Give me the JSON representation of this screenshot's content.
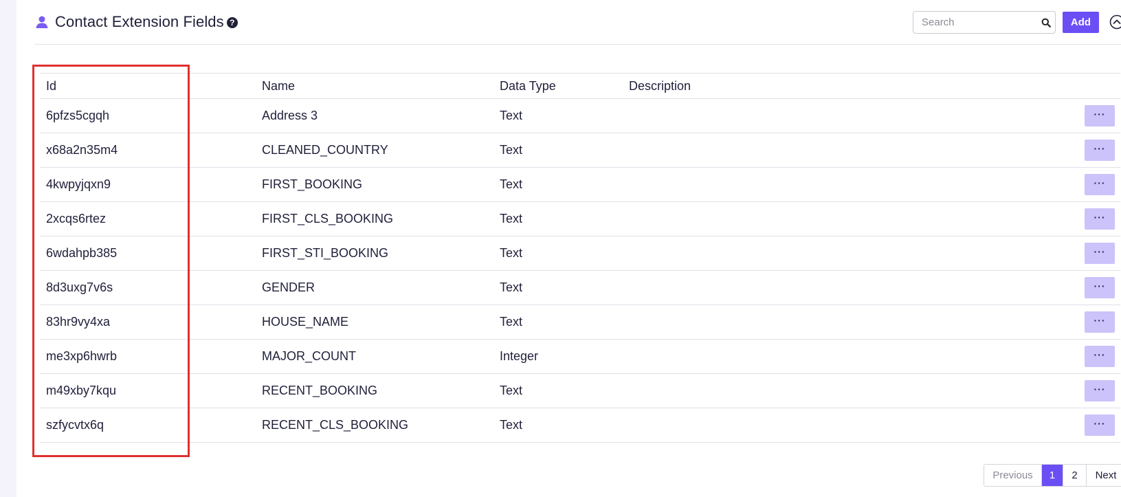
{
  "header": {
    "title": "Contact Extension Fields",
    "help_glyph": "?",
    "search_placeholder": "Search",
    "add_label": "Add"
  },
  "table": {
    "columns": [
      "Id",
      "Name",
      "Data Type",
      "Description"
    ],
    "rows": [
      {
        "id": "6pfzs5cgqh",
        "name": "Address 3",
        "type": "Text",
        "description": ""
      },
      {
        "id": "x68a2n35m4",
        "name": "CLEANED_COUNTRY",
        "type": "Text",
        "description": ""
      },
      {
        "id": "4kwpyjqxn9",
        "name": "FIRST_BOOKING",
        "type": "Text",
        "description": ""
      },
      {
        "id": "2xcqs6rtez",
        "name": "FIRST_CLS_BOOKING",
        "type": "Text",
        "description": ""
      },
      {
        "id": "6wdahpb385",
        "name": "FIRST_STI_BOOKING",
        "type": "Text",
        "description": ""
      },
      {
        "id": "8d3uxg7v6s",
        "name": "GENDER",
        "type": "Text",
        "description": ""
      },
      {
        "id": "83hr9vy4xa",
        "name": "HOUSE_NAME",
        "type": "Text",
        "description": ""
      },
      {
        "id": "me3xp6hwrb",
        "name": "MAJOR_COUNT",
        "type": "Integer",
        "description": ""
      },
      {
        "id": "m49xby7kqu",
        "name": "RECENT_BOOKING",
        "type": "Text",
        "description": ""
      },
      {
        "id": "szfycvtx6q",
        "name": "RECENT_CLS_BOOKING",
        "type": "Text",
        "description": ""
      }
    ],
    "row_action_label": "···"
  },
  "pagination": {
    "previous_label": "Previous",
    "pages": [
      "1",
      "2"
    ],
    "current_page": "1",
    "next_label": "Next"
  },
  "colors": {
    "accent": "#6c4ef5",
    "row_action_bg": "#cbc3f9",
    "highlight": "#e03030"
  },
  "icons": {
    "title_icon": "user-icon",
    "help_icon": "question-circle-icon",
    "search_icon": "search-icon",
    "collapse_icon": "chevron-up-circle-icon",
    "row_action_icon": "ellipsis-icon"
  }
}
